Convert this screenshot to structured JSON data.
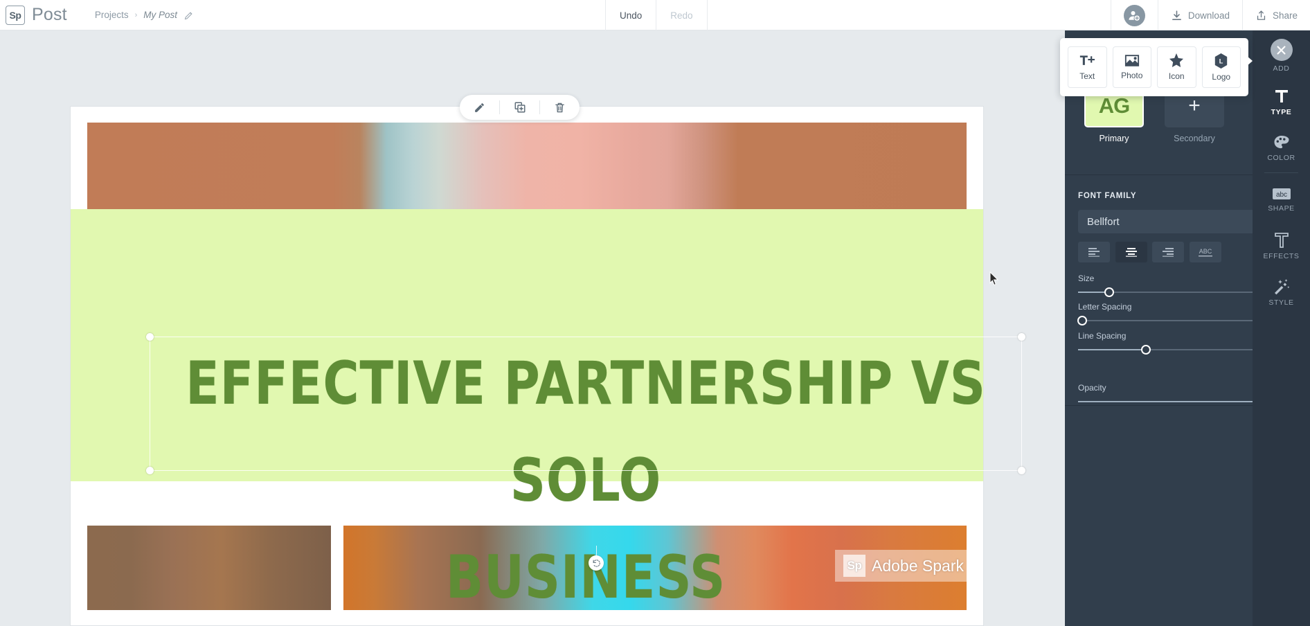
{
  "topbar": {
    "logo_mark": "Sp",
    "app_title": "Post",
    "breadcrumb": {
      "root": "Projects",
      "separator": "›",
      "current": "My Post",
      "edit_icon": "pencil-icon"
    },
    "history": {
      "undo": "Undo",
      "redo": "Redo"
    },
    "actions": {
      "invite_icon": "add-person-icon",
      "download": "Download",
      "download_icon": "download-icon",
      "share": "Share",
      "share_icon": "share-icon"
    }
  },
  "float_toolbar": {
    "edit_icon": "pencil-icon",
    "duplicate_icon": "duplicate-icon",
    "delete_icon": "trash-icon"
  },
  "canvas": {
    "headline": "EFFECTIVE PARTNERSHIP VS SOLO\nBUSINESS",
    "headline_color": "#5f8d36",
    "band_color": "#e1f8b0",
    "rotate_icon": "rotate-icon",
    "watermark": {
      "badge": "Sp",
      "text": "Adobe Spark"
    }
  },
  "add_popup": {
    "items": [
      {
        "label": "Text",
        "icon": "text-plus-icon"
      },
      {
        "label": "Photo",
        "icon": "photo-icon"
      },
      {
        "label": "Icon",
        "icon": "star-icon"
      },
      {
        "label": "Logo",
        "icon": "logo-icon"
      }
    ]
  },
  "type_panel": {
    "swatches": [
      {
        "label": "Primary",
        "sample": "AG",
        "bg": "#e1f8b0",
        "fg": "#5f8d36",
        "selected": true
      },
      {
        "label": "Secondary",
        "sample": "+",
        "bg": "#3c4a59",
        "fg": "#e8edf2",
        "selected": false
      }
    ],
    "font_family_title": "FONT FAMILY",
    "font_family_value": "Bellfort",
    "chevron_icon": "chevron-down-icon",
    "alignment": [
      {
        "name": "align-left",
        "icon": "align-left-icon",
        "active": false
      },
      {
        "name": "align-center",
        "icon": "align-center-icon",
        "active": true
      },
      {
        "name": "align-right",
        "icon": "align-right-icon",
        "active": false
      },
      {
        "name": "text-case",
        "icon": "abc-icon",
        "active": false
      }
    ],
    "sliders": [
      {
        "label": "Size",
        "percent": 16
      },
      {
        "label": "Letter Spacing",
        "percent": 2
      },
      {
        "label": "Line Spacing",
        "percent": 35
      },
      {
        "label": "Opacity",
        "percent": 97
      }
    ]
  },
  "rail": {
    "items": [
      {
        "label": "ADD",
        "icon": "close-icon",
        "active": false,
        "is_close": true
      },
      {
        "label": "TYPE",
        "icon": "type-icon",
        "active": true,
        "is_close": false
      },
      {
        "label": "COLOR",
        "icon": "palette-icon",
        "active": false,
        "is_close": false
      },
      {
        "label": "SHAPE",
        "icon": "abc-box-icon",
        "active": false,
        "is_close": false
      },
      {
        "label": "EFFECTS",
        "icon": "effects-icon",
        "active": false,
        "is_close": false
      },
      {
        "label": "STYLE",
        "icon": "magic-wand-icon",
        "active": false,
        "is_close": false
      }
    ]
  }
}
